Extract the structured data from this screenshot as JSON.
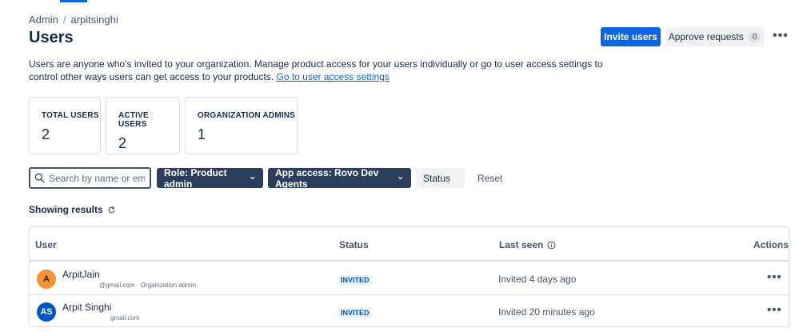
{
  "breadcrumb": {
    "root": "Admin",
    "separator": "/",
    "site": "arpitsinghi"
  },
  "page_title": "Users",
  "actions": {
    "invite_label": "Invite users",
    "approve_label": "Approve requests",
    "approve_count": "0",
    "more": "•••"
  },
  "description": {
    "text": "Users are anyone who’s invited to your organization. Manage product access for your users individually or go to user access settings to control other ways users can get access to your products.",
    "link": "Go to user access settings"
  },
  "stats": [
    {
      "label": "TOTAL USERS",
      "value": "2"
    },
    {
      "label": "ACTIVE USERS",
      "value": "2"
    },
    {
      "label": "ORGANIZATION ADMINS",
      "value": "1"
    }
  ],
  "filters": {
    "search_placeholder": "Search by name or email",
    "role": "Role: Product admin",
    "app_access": "App access: Rovo Dev Agents",
    "status": "Status",
    "reset": "Reset"
  },
  "showing_results": "Showing results",
  "table": {
    "headers": {
      "user": "User",
      "status": "Status",
      "last_seen": "Last seen",
      "actions": "Actions"
    },
    "rows": [
      {
        "initials": "A",
        "avatar_color": "#f79232",
        "name": "ArpitJain",
        "meta": "@gmail.com · Organization admin",
        "status": "INVITED",
        "last_seen": "Invited 4 days ago",
        "more": "•••"
      },
      {
        "initials": "AS",
        "avatar_color": "#0055cc",
        "name": "Arpit Singhi",
        "meta": "gmail.com",
        "status": "INVITED",
        "last_seen": "Invited 20 minutes ago",
        "more": "•••"
      }
    ]
  },
  "icons": {
    "search": "search-icon",
    "chevron": "chevron-down-icon",
    "refresh": "refresh-icon",
    "info": "info-icon",
    "more": "more-icon"
  },
  "colors": {
    "accent": "#0c66e4",
    "filter_dark": "#2c3e5d",
    "text": "#172b4d"
  }
}
